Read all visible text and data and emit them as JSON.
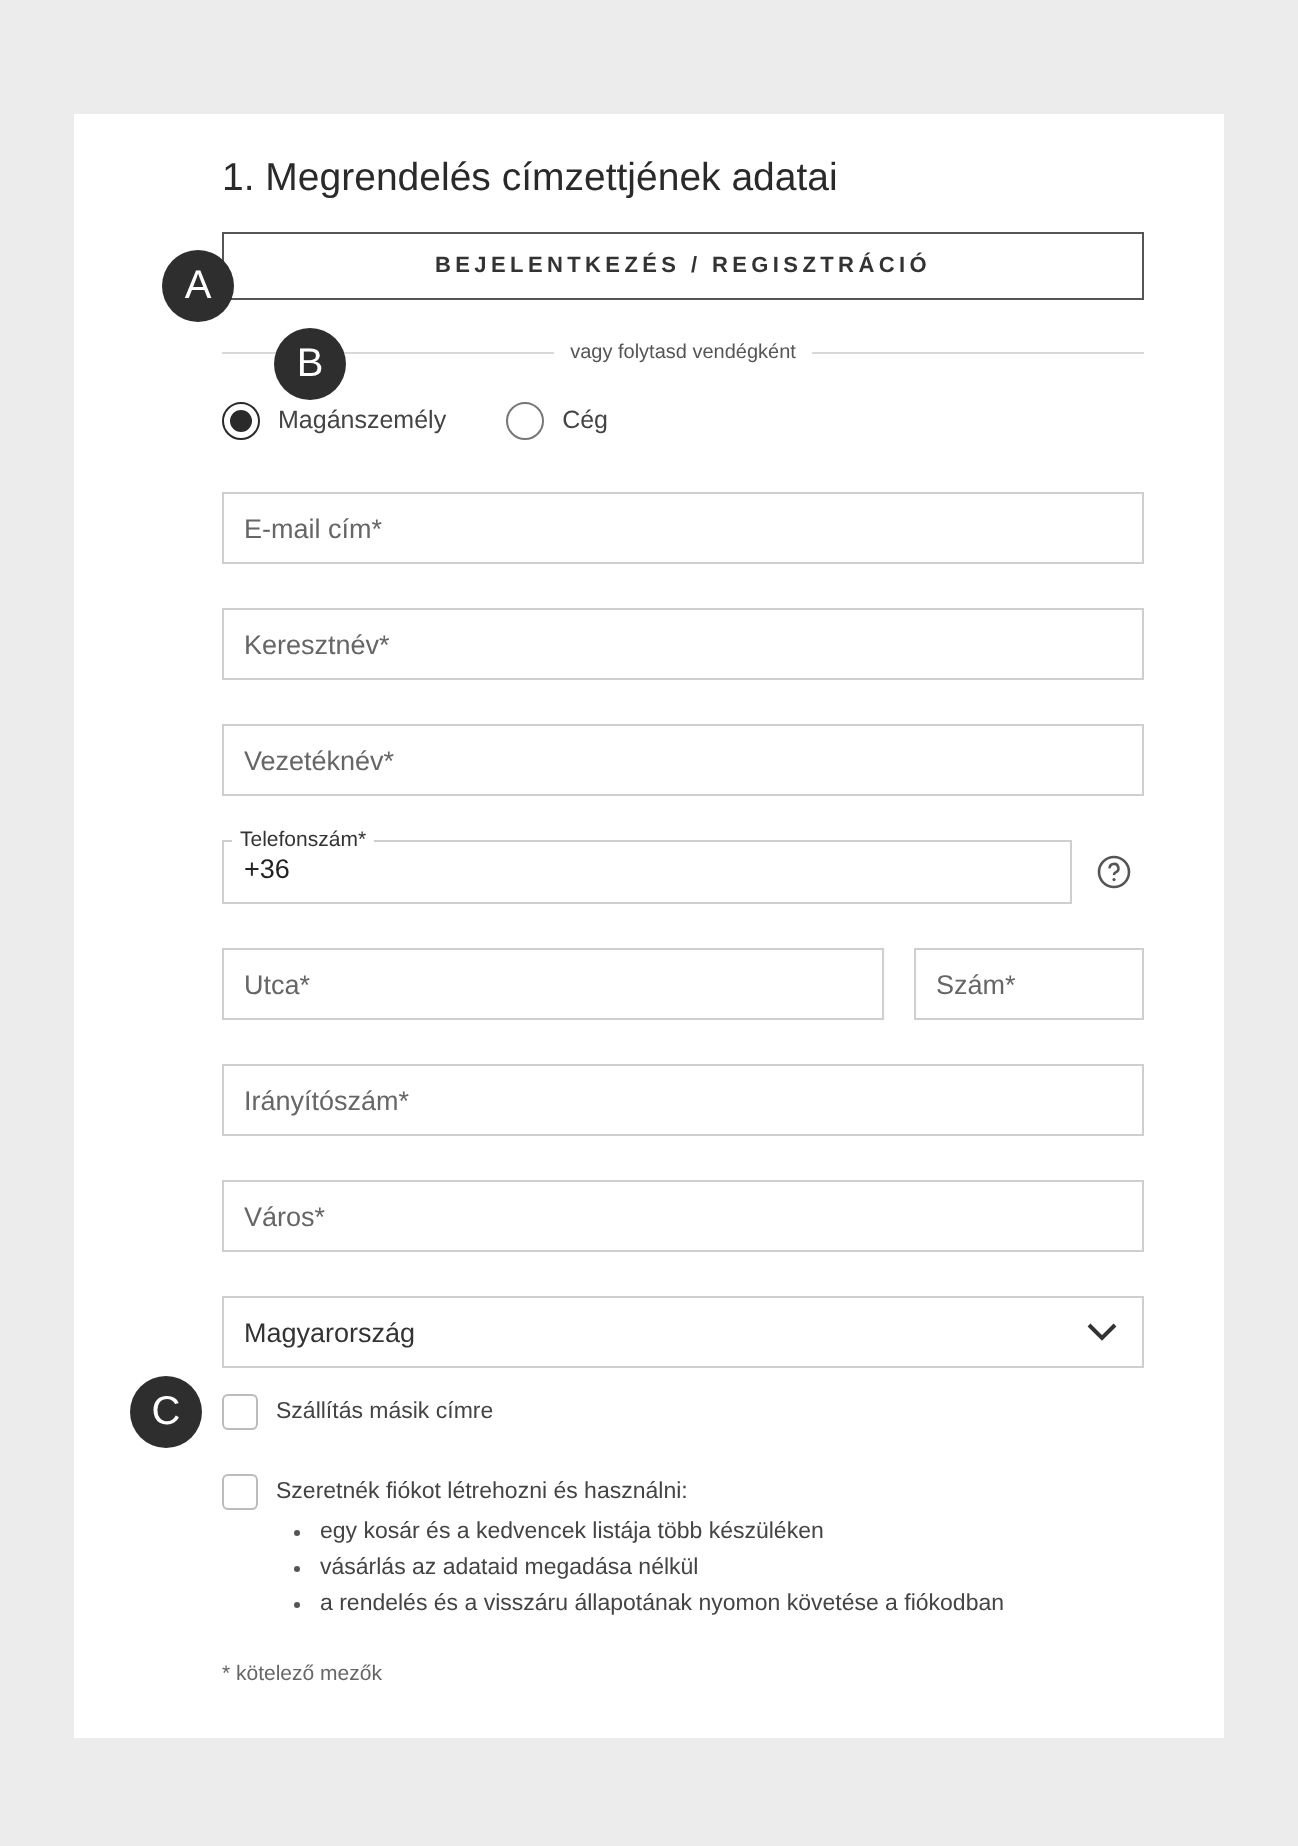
{
  "title": "1. Megrendelés címzettjének adatai",
  "login_button": {
    "label": "BEJELENTKEZÉS / REGISZTRÁCIÓ",
    "marker": "A"
  },
  "divider": {
    "text": "vagy folytasd vendégként",
    "marker": "B"
  },
  "customer_type": [
    {
      "label": "Magánszemély",
      "selected": true
    },
    {
      "label": "Cég",
      "selected": false
    }
  ],
  "fields": [
    {
      "kind": "input",
      "placeholder": "E-mail cím*"
    },
    {
      "kind": "input",
      "placeholder": "Keresztnév*"
    },
    {
      "kind": "input",
      "placeholder": "Vezetéknév*"
    },
    {
      "kind": "phone",
      "label": "Telefonszám*",
      "value": "+36"
    },
    {
      "kind": "pair",
      "fields": [
        {
          "placeholder": "Utca*"
        },
        {
          "placeholder": "Szám*"
        }
      ]
    },
    {
      "kind": "input",
      "placeholder": "Irányítószám*"
    },
    {
      "kind": "input",
      "placeholder": "Város*"
    },
    {
      "kind": "select",
      "value": "Magyarország"
    }
  ],
  "checkboxes": [
    {
      "label": "Szállítás másik címre",
      "checked": false,
      "marker": "C"
    },
    {
      "label": "Szeretnék fiókot létrehozni és használni:",
      "checked": false,
      "bullets": [
        "egy kosár és a kedvencek listája több készüléken",
        "vásárlás az adataid megadása nélkül",
        "a rendelés és a visszáru állapotának nyomon követése a fiókodban"
      ]
    }
  ],
  "note": "* kötelező mezők"
}
